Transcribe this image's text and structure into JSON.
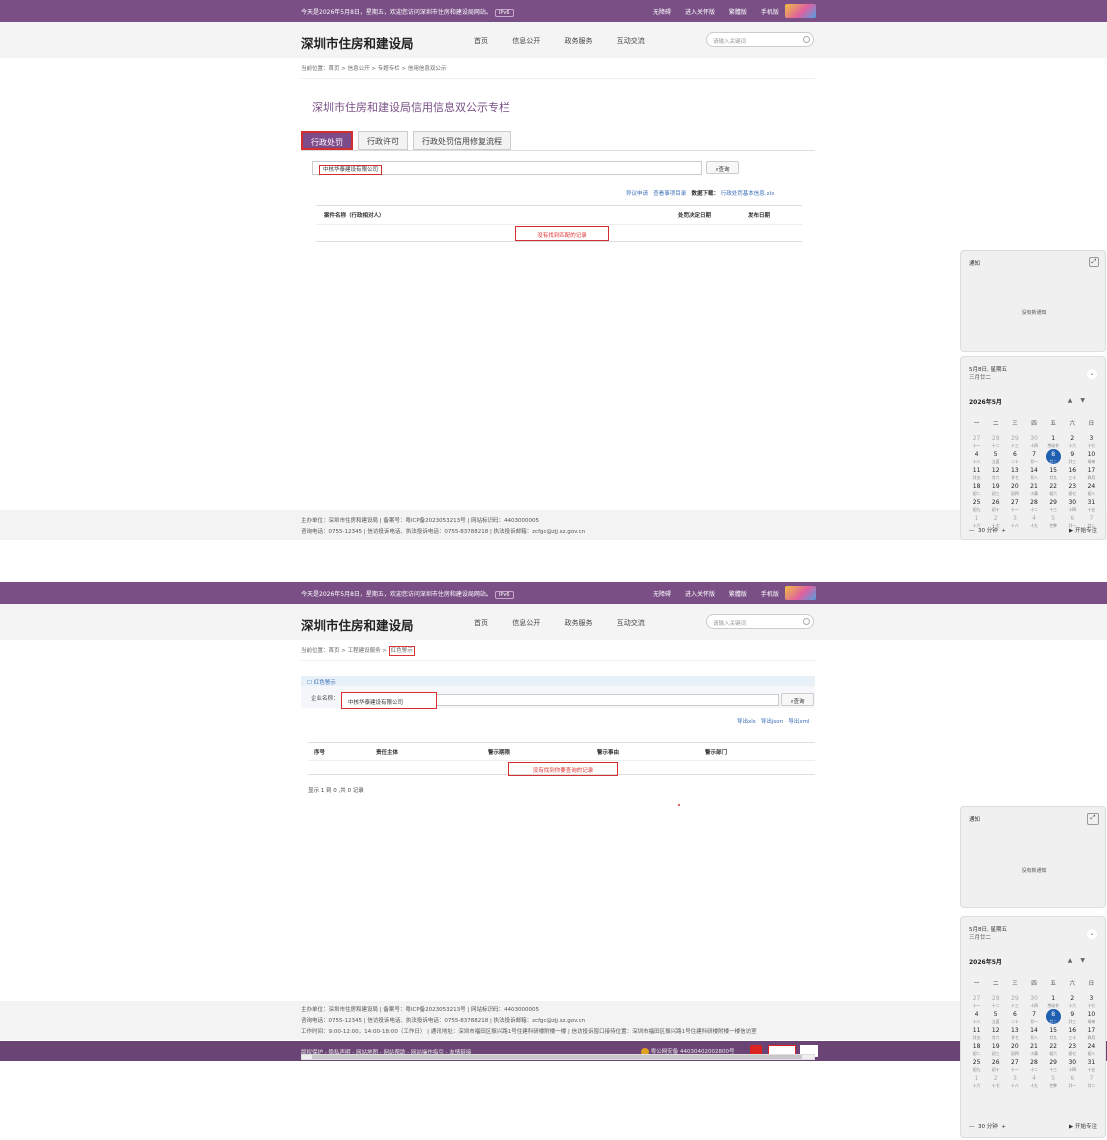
{
  "site": {
    "welcome": "今天是2026年5月8日，星期五，欢迎您访问深圳市住房和建设局网站。",
    "ipv6": "IPv6",
    "top_links": [
      "无障碍",
      "进入关怀版",
      "繁體版",
      "手机版"
    ],
    "logo": "深圳市住房和建设局",
    "nav": [
      "首页",
      "信息公开",
      "政务服务",
      "互动交流"
    ],
    "search_placeholder": "请输入关键词"
  },
  "page1": {
    "breadcrumb_prefix": "当前位置：",
    "breadcrumb": "首页 > 信息公开 > 专题专栏 > 信用信息双公示",
    "title": "深圳市住房和建设局信用信息双公示专栏",
    "tabs": [
      "行政处罚",
      "行政许可",
      "行政处罚信用修复流程"
    ],
    "search_value": "中核华泰建设有限公司",
    "query_button": "查询",
    "links": [
      "异议申请",
      "查看事项目录"
    ],
    "download_label": "数据下载：",
    "download_link": "行政处罚基本信息.xls",
    "columns": [
      "案件名称（行政相对人）",
      "处罚决定日期",
      "发布日期"
    ],
    "empty_message": "没有找到匹配的记录"
  },
  "page2": {
    "breadcrumb_prefix": "当前位置：",
    "breadcrumb": "首页 > 工程建设服务 > ",
    "breadcrumb_current": "红色警示",
    "panel_title": "红色警示",
    "company_label": "企业名称：",
    "search_value": "中核华泰建设有限公司",
    "query_button": "查询",
    "exports": [
      "导出xls",
      "导出json",
      "导出xml"
    ],
    "columns": [
      "序号",
      "责任主体",
      "警示期限",
      "警示事由",
      "警示部门"
    ],
    "empty_message": "没有找到你要查询的记录",
    "pagination": "显示 1 到 0 ,共 0 记录"
  },
  "footer": {
    "line1": "主办单位：深圳市住房和建设局  |  备案号：粤ICP备2023053213号  |  网站标识码：4403000005",
    "line2": "咨询电话：0755-12345  |  信访投诉电话、执法投诉电话：0755-83788218  |  执法投诉邮箱：zcfgc@zjj.sz.gov.cn",
    "line3": "工作时间：9:00-12:00，14:00-18:00（工作日）  |  通讯地址：深圳市福田区振兴路1号住建科研楼附楼一楼  |  信访投诉窗口接待位置：深圳市福田区振兴路1号住建科研楼附楼一楼信访室",
    "bottom_links": "版权保护 - 隐私声明 - 网站地图 - 网站帮助 - 网站操作指引 - 友情链接",
    "police_record": "粤公网安备 44030402002800号"
  },
  "notification": {
    "title": "通知",
    "empty": "没有新通知"
  },
  "calendar": {
    "date_line": "5月8日, 星期五",
    "lunar_line": "三月廿二",
    "month_label": "2026年5月",
    "weekdays": [
      "一",
      "二",
      "三",
      "四",
      "五",
      "六",
      "日"
    ],
    "focus_minutes": "30 分钟",
    "focus_button": "开始专注",
    "weeks": [
      [
        [
          "27",
          "十一"
        ],
        [
          "28",
          "十二"
        ],
        [
          "29",
          "十三"
        ],
        [
          "30",
          "十四"
        ],
        [
          "1",
          "劳动节"
        ],
        [
          "2",
          "十六"
        ],
        [
          "3",
          "十七"
        ]
      ],
      [
        [
          "4",
          "十八"
        ],
        [
          "5",
          "立夏"
        ],
        [
          "6",
          "二十"
        ],
        [
          "7",
          "廿一"
        ],
        [
          "8",
          "廿二"
        ],
        [
          "9",
          "廿三"
        ],
        [
          "10",
          "母亲"
        ]
      ],
      [
        [
          "11",
          "廿五"
        ],
        [
          "12",
          "廿六"
        ],
        [
          "13",
          "廿七"
        ],
        [
          "14",
          "廿八"
        ],
        [
          "15",
          "廿九"
        ],
        [
          "16",
          "三十"
        ],
        [
          "17",
          "四月"
        ]
      ],
      [
        [
          "18",
          "初二"
        ],
        [
          "19",
          "初三"
        ],
        [
          "20",
          "初四"
        ],
        [
          "21",
          "小满"
        ],
        [
          "22",
          "初六"
        ],
        [
          "23",
          "初七"
        ],
        [
          "24",
          "初八"
        ]
      ],
      [
        [
          "25",
          "初九"
        ],
        [
          "26",
          "初十"
        ],
        [
          "27",
          "十一"
        ],
        [
          "28",
          "十二"
        ],
        [
          "29",
          "十三"
        ],
        [
          "30",
          "十四"
        ],
        [
          "31",
          "十五"
        ]
      ],
      [
        [
          "1",
          "十六"
        ],
        [
          "2",
          "十七"
        ],
        [
          "3",
          "十八"
        ],
        [
          "4",
          "十九"
        ],
        [
          "5",
          "芒种"
        ],
        [
          "6",
          "廿一"
        ],
        [
          "7",
          "廿二"
        ]
      ]
    ]
  }
}
